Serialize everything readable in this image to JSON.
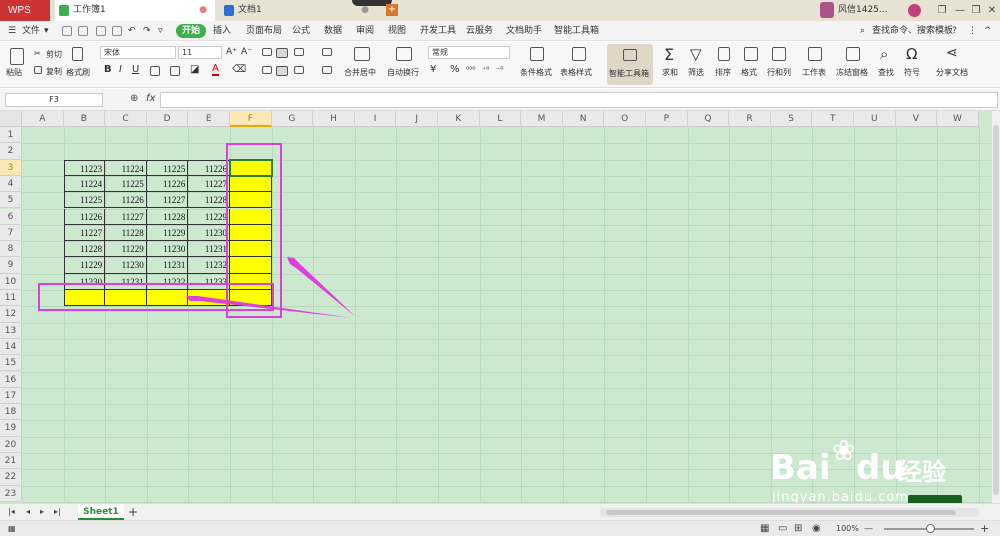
{
  "titlebar": {
    "app": "WPS",
    "tabs": [
      {
        "label": "工作簿1",
        "icon": "spreadsheet-icon",
        "active": true,
        "marker": "●"
      },
      {
        "label": "文档1",
        "icon": "document-icon",
        "active": false,
        "marker": "●"
      }
    ],
    "add_tab": "+",
    "user": "风信1425...",
    "window_buttons": [
      "❐",
      "—",
      "❐",
      "✕"
    ]
  },
  "menubar": {
    "file": "文件",
    "items": [
      "开始",
      "插入",
      "页面布局",
      "公式",
      "数据",
      "审阅",
      "视图",
      "开发工具",
      "云服务",
      "文档助手",
      "智能工具箱"
    ],
    "active": "开始",
    "search": "查找命令、搜索模板",
    "help": "?",
    "more": "⋮",
    "collapse": "^"
  },
  "ribbon": {
    "paste": "粘贴",
    "cut": "剪切",
    "copy": "复制",
    "format_painter": "格式刷",
    "font_name": "宋体",
    "font_size": "11",
    "grow_font": "A⁺",
    "shrink_font": "A⁻",
    "bold": "B",
    "italic": "I",
    "underline": "U",
    "font_color": "A",
    "merge_center": "合并居中",
    "wrap_text": "自动换行",
    "number_format": "常规",
    "currency": "¥",
    "percent": "%",
    "conditional_format": "条件格式",
    "table_style": "表格样式",
    "smart_toolbox": "智能工具箱",
    "sum": "求和",
    "filter": "筛选",
    "sort": "排序",
    "format": "格式",
    "rows_cols": "行和列",
    "worksheet": "工作表",
    "freeze": "冻结窗格",
    "find": "查找",
    "symbol": "符号",
    "share": "分享文档"
  },
  "formula_bar": {
    "name_box": "F3",
    "fx": "fx",
    "value": ""
  },
  "grid": {
    "columns": [
      "A",
      "B",
      "C",
      "D",
      "E",
      "F",
      "G",
      "H",
      "I",
      "J",
      "K",
      "L",
      "M",
      "N",
      "O",
      "P",
      "Q",
      "R",
      "S",
      "T",
      "U",
      "V",
      "W"
    ],
    "rows": [
      "1",
      "2",
      "3",
      "4",
      "5",
      "6",
      "7",
      "8",
      "9",
      "10",
      "11",
      "12",
      "13",
      "14",
      "15",
      "16",
      "17",
      "18",
      "19",
      "20",
      "21",
      "22",
      "23"
    ],
    "selected_column": "F",
    "selected_row": "3",
    "table": [
      [
        "11223",
        "11224",
        "11225",
        "11226",
        ""
      ],
      [
        "11224",
        "11225",
        "11226",
        "11227",
        ""
      ],
      [
        "11225",
        "11226",
        "11227",
        "11228",
        ""
      ],
      [
        "11226",
        "11227",
        "11228",
        "11229",
        ""
      ],
      [
        "11227",
        "11228",
        "11229",
        "11230",
        ""
      ],
      [
        "11228",
        "11229",
        "11230",
        "11231",
        ""
      ],
      [
        "11229",
        "11230",
        "11231",
        "11232",
        ""
      ],
      [
        "11230",
        "11231",
        "11232",
        "11233",
        ""
      ],
      [
        "",
        "",
        "",
        "",
        ""
      ]
    ],
    "fill_color": "#ffff00",
    "annotation_color": "#dd3fdd"
  },
  "sheetbar": {
    "sheet": "Sheet1",
    "add": "+"
  },
  "statusbar": {
    "zoom": "100%",
    "zoom_out": "—",
    "zoom_in": "+"
  },
  "watermark": {
    "brand": "Bai",
    "brand2": "du",
    "cn": "经验",
    "url": "jingyan.baidu.com"
  }
}
